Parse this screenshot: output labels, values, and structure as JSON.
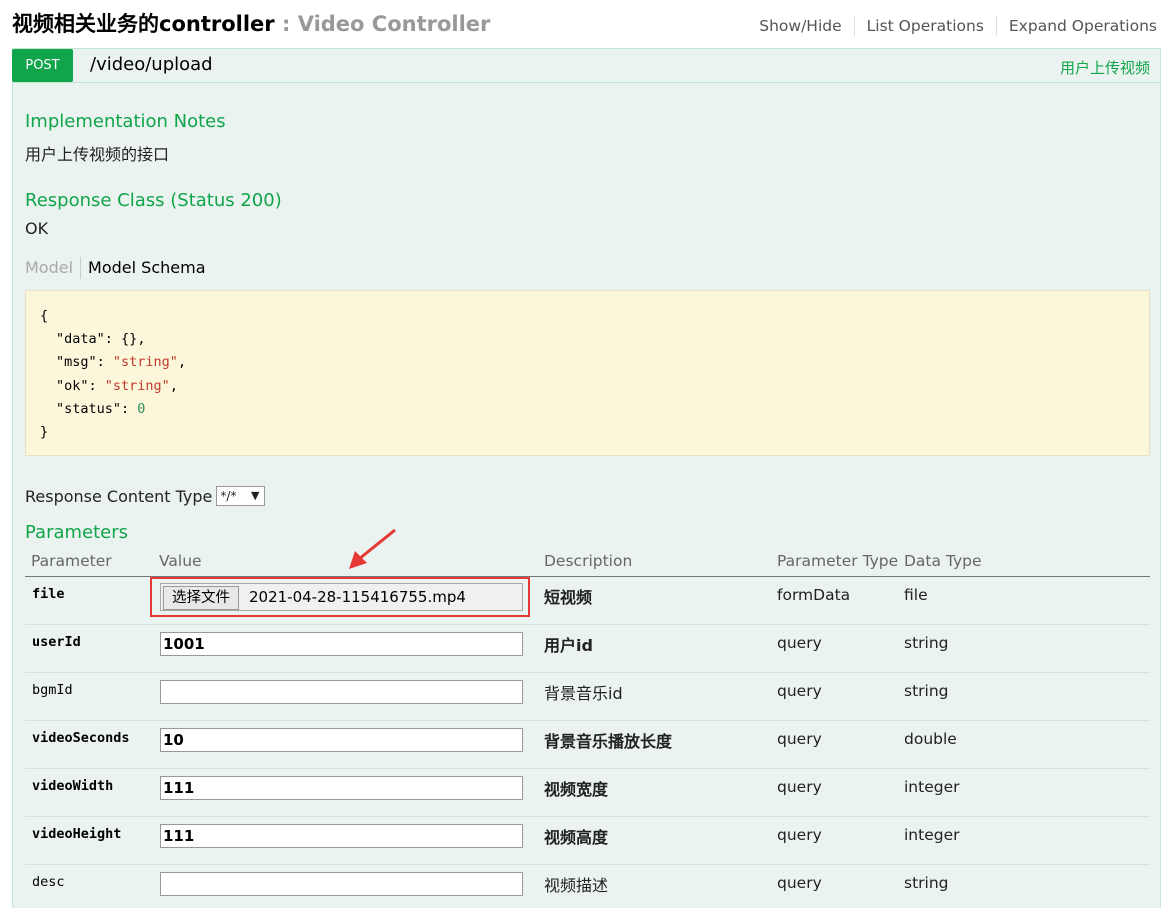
{
  "header": {
    "title_cn": "视频相关业务的controller",
    "separator": " : ",
    "title_en": "Video Controller",
    "links": [
      "Show/Hide",
      "List Operations",
      "Expand Operations"
    ]
  },
  "operation": {
    "method": "POST",
    "path": "/video/upload",
    "summary": "用户上传视频",
    "impl_notes_heading": "Implementation Notes",
    "impl_notes_text": "用户上传视频的接口",
    "response_class_heading": "Response Class (Status 200)",
    "response_class_text": "OK",
    "model_tab": "Model",
    "schema_tab": "Model Schema",
    "schema": {
      "data_key": "\"data\"",
      "data_val": "{}",
      "msg_key": "\"msg\"",
      "msg_val": "\"string\"",
      "ok_key": "\"ok\"",
      "ok_val": "\"string\"",
      "status_key": "\"status\"",
      "status_val": "0"
    },
    "response_content_type_label": "Response Content Type",
    "response_content_type_value": "*/*",
    "parameters_heading": "Parameters"
  },
  "params_table": {
    "headers": [
      "Parameter",
      "Value",
      "Description",
      "Parameter Type",
      "Data Type"
    ],
    "rows": [
      {
        "name": "file",
        "value": "",
        "file_button": "选择文件",
        "file_name": "2021-04-28-115416755.mp4",
        "description": "短视频",
        "param_type": "formData",
        "data_type": "file",
        "required": true
      },
      {
        "name": "userId",
        "value": "1001",
        "description": "用户id",
        "param_type": "query",
        "data_type": "string",
        "required": true
      },
      {
        "name": "bgmId",
        "value": "",
        "description": "背景音乐id",
        "param_type": "query",
        "data_type": "string",
        "required": false
      },
      {
        "name": "videoSeconds",
        "value": "10",
        "description": "背景音乐播放长度",
        "param_type": "query",
        "data_type": "double",
        "required": true
      },
      {
        "name": "videoWidth",
        "value": "111",
        "description": "视频宽度",
        "param_type": "query",
        "data_type": "integer",
        "required": true
      },
      {
        "name": "videoHeight",
        "value": "111",
        "description": "视频高度",
        "param_type": "query",
        "data_type": "integer",
        "required": true
      },
      {
        "name": "desc",
        "value": "",
        "description": "视频描述",
        "param_type": "query",
        "data_type": "string",
        "required": false
      }
    ]
  },
  "colors": {
    "accent_green": "#10a54a",
    "op_background": "#ebf3f0",
    "schema_background": "#fcf6db",
    "annotation_red": "#e53935"
  }
}
